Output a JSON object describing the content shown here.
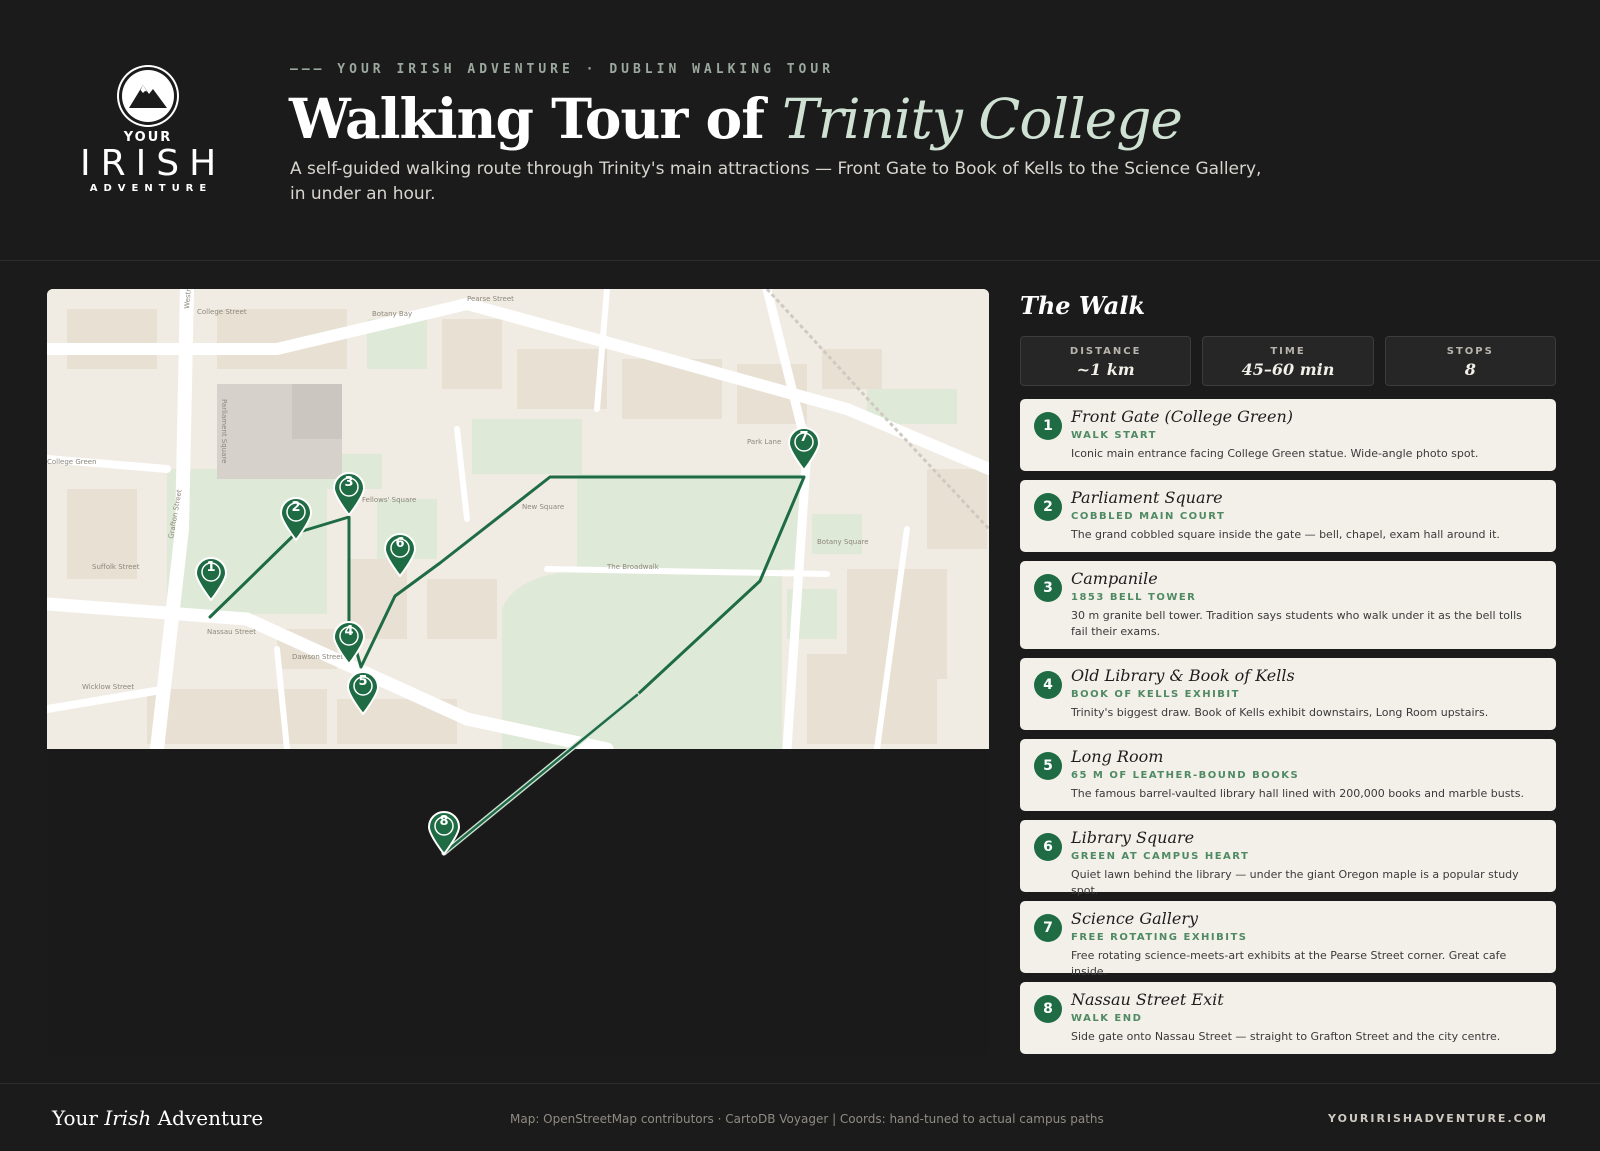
{
  "brand": {
    "logo_your": "YOUR",
    "logo_irish": "IRISH",
    "logo_adventure": "ADVENTURE",
    "logo_icon": "mountain-icon",
    "accent_color": "#1e6b44"
  },
  "header": {
    "kicker": "——— YOUR IRISH ADVENTURE · DUBLIN WALKING TOUR",
    "title_main": "Walking Tour of ",
    "title_accent": "Trinity College",
    "subtitle": "A self-guided walking route through Trinity's main attractions — Front Gate to Book of Kells to the Science Gallery, in under an hour."
  },
  "map": {
    "street_labels": [
      "College Street",
      "Pearse Street",
      "Botany Bay",
      "Nassau Street",
      "Grafton Street",
      "Suffolk Street",
      "Wicklow Street",
      "Dawson Street",
      "New Square",
      "Botany Square",
      "The Broadwalk",
      "Park Lane",
      "Parliament Square",
      "Fellows' Square",
      "Westmoreland Street",
      "College Green",
      "Library Square"
    ],
    "markers": [
      {
        "num": "1"
      },
      {
        "num": "2"
      },
      {
        "num": "3"
      },
      {
        "num": "4"
      },
      {
        "num": "5"
      },
      {
        "num": "6"
      },
      {
        "num": "7"
      },
      {
        "num": "8"
      }
    ]
  },
  "sidebar": {
    "title": "The Walk",
    "stats": [
      {
        "label": "DISTANCE",
        "value": "~1 km"
      },
      {
        "label": "TIME",
        "value": "45–60 min"
      },
      {
        "label": "STOPS",
        "value": "8"
      }
    ],
    "stops": [
      {
        "num": "1",
        "name": "Front Gate (College Green)",
        "tag": "WALK START",
        "desc": "Iconic main entrance facing College Green statue. Wide-angle photo spot."
      },
      {
        "num": "2",
        "name": "Parliament Square",
        "tag": "COBBLED MAIN COURT",
        "desc": "The grand cobbled square inside the gate — bell, chapel, exam hall around it."
      },
      {
        "num": "3",
        "name": "Campanile",
        "tag": "1853 BELL TOWER",
        "desc": "30 m granite bell tower. Tradition says students who walk under it as the bell tolls fail their exams."
      },
      {
        "num": "4",
        "name": "Old Library & Book of Kells",
        "tag": "BOOK OF KELLS EXHIBIT",
        "desc": "Trinity's biggest draw. Book of Kells exhibit downstairs, Long Room upstairs."
      },
      {
        "num": "5",
        "name": "Long Room",
        "tag": "65 M OF LEATHER-BOUND BOOKS",
        "desc": "The famous barrel-vaulted library hall lined with 200,000 books and marble busts."
      },
      {
        "num": "6",
        "name": "Library Square",
        "tag": "GREEN AT CAMPUS HEART",
        "desc": "Quiet lawn behind the library — under the giant Oregon maple is a popular study spot."
      },
      {
        "num": "7",
        "name": "Science Gallery",
        "tag": "FREE ROTATING EXHIBITS",
        "desc": "Free rotating science-meets-art exhibits at the Pearse Street corner. Great cafe inside."
      },
      {
        "num": "8",
        "name": "Nassau Street Exit",
        "tag": "WALK END",
        "desc": "Side gate onto Nassau Street — straight to Grafton Street and the city centre."
      }
    ]
  },
  "footer": {
    "brand_pre": "Your ",
    "brand_accent": "Irish",
    "brand_post": " Adventure",
    "credit": "Map: OpenStreetMap contributors · CartoDB Voyager | Coords: hand-tuned to actual campus paths",
    "url": "YOURIRISHADVENTURE.COM"
  }
}
